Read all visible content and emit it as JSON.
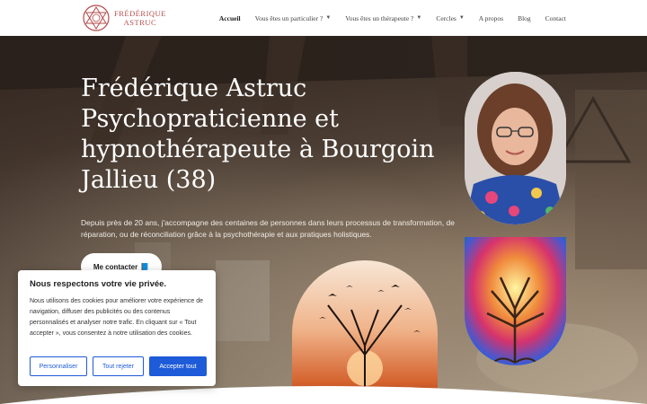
{
  "header": {
    "logo_line1": "FRÉDÉRIQUE",
    "logo_line2": "ASTRUC",
    "brand_color": "#b44a4a",
    "nav": [
      {
        "label": "Accueil",
        "active": true
      },
      {
        "label": "Vous êtes un particulier ?",
        "dropdown": true
      },
      {
        "label": "Vous êtes un thérapeute ?",
        "dropdown": true
      },
      {
        "label": "Cercles",
        "dropdown": true
      },
      {
        "label": "A propos"
      },
      {
        "label": "Blog"
      },
      {
        "label": "Contact"
      }
    ]
  },
  "hero": {
    "title": "Frédérique Astruc Psychopraticienne et hypnothérapeute à Bourgoin Jallieu (38)",
    "text": "Depuis près de 20 ans, j'accompagne des centaines de personnes dans leurs processus de transformation, de réparation, ou de réconciliation grâce à la psychothérapie et aux pratiques holistiques.",
    "cta_label": "Me contacter",
    "cta_icon": "📘"
  },
  "cookie": {
    "title": "Nous respectons votre vie privée.",
    "text": "Nous utilisons des cookies pour améliorer votre expérience de navigation, diffuser des publicités ou des contenus personnalisés et analyser notre trafic. En cliquant sur « Tout accepter », vous consentez à notre utilisation des cookies.",
    "btn_customize": "Personnaliser",
    "btn_reject": "Tout rejeter",
    "btn_accept": "Accepter tout",
    "accent": "#1e5bd8"
  }
}
